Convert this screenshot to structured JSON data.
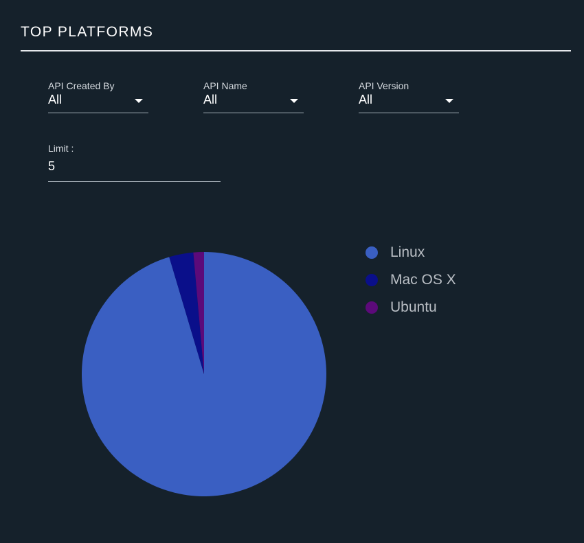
{
  "header": {
    "title": "TOP PLATFORMS"
  },
  "filters": [
    {
      "label": "API Created By",
      "value": "All"
    },
    {
      "label": "API Name",
      "value": "All"
    },
    {
      "label": "API Version",
      "value": "All"
    }
  ],
  "limit": {
    "label": "Limit :",
    "value": "5"
  },
  "colors": {
    "background": "#15212b",
    "accent_line": "#e6e9ec"
  },
  "chart_data": {
    "type": "pie",
    "title": "",
    "categories": [
      "Linux",
      "Mac OS X",
      "Ubuntu"
    ],
    "values": [
      95.4,
      3.2,
      1.4
    ],
    "colors": [
      "#3a5fc2",
      "#0a0f8a",
      "#5c0a7a"
    ],
    "legend_position": "right",
    "start_angle_deg": 0,
    "direction": "clockwise"
  }
}
